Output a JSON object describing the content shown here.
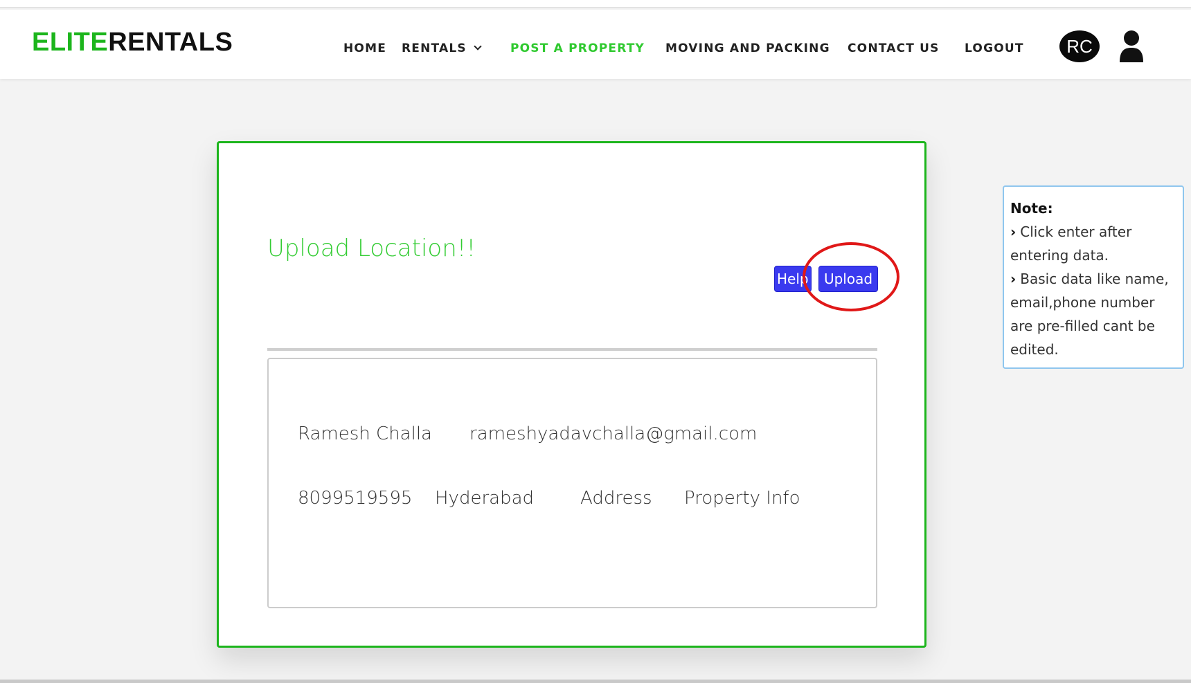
{
  "brand": {
    "accent": "ELITE",
    "rest": "RENTALS"
  },
  "nav": {
    "home": "HOME",
    "rentals": "RENTALS",
    "post_property": "POST A PROPERTY",
    "moving": "MOVING AND PACKING",
    "contact": "CONTACT US",
    "logout": "LOGOUT"
  },
  "user": {
    "initials": "RC",
    "icon": "user-icon"
  },
  "form": {
    "title": "Upload Location!!",
    "help_label": "Help",
    "upload_label": "Upload",
    "fields": {
      "name": "Ramesh Challa",
      "email": "rameshyadavchalla@gmail.com",
      "phone": "8099519595",
      "city": "Hyderabad",
      "address": "Address",
      "property_info": "Property Info"
    }
  },
  "note": {
    "title": "Note:",
    "line1": "Click enter after entering data.",
    "line2": "Basic data like name, email,phone number are pre-filled cant be edited."
  },
  "colors": {
    "brand_accent": "#1cb51c",
    "active_nav": "#2fc92f",
    "button": "#3a3aef",
    "highlight": "#e01818",
    "note_border": "#8fc6ee"
  }
}
